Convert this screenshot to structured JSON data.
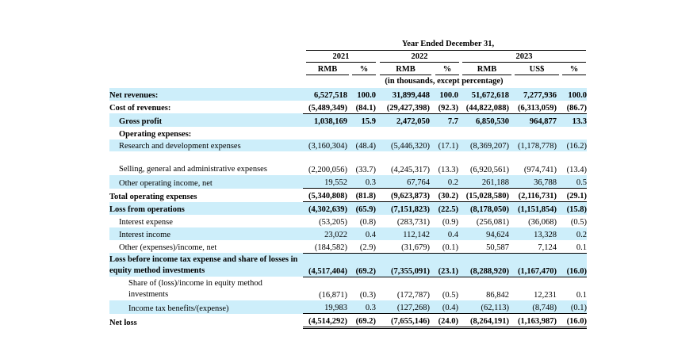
{
  "header": {
    "period_title": "Year Ended December 31,",
    "years": [
      "2021",
      "2022",
      "2023"
    ],
    "currencies": [
      "RMB",
      "%",
      "RMB",
      "%",
      "RMB",
      "US$",
      "%"
    ],
    "units_note": "(in thousands, except percentage)"
  },
  "rows": [
    {
      "label": "Net revenues:",
      "bold": true,
      "shaded": true,
      "indent": 0,
      "values": [
        "6,527,518",
        "100.0",
        "31,899,448",
        "100.0",
        "51,672,618",
        "7,277,936",
        "100.0"
      ]
    },
    {
      "label": "Cost of revenues:",
      "bold": true,
      "shaded": false,
      "indent": 0,
      "values": [
        "(5,489,349)",
        "(84.1)",
        "(29,427,398)",
        "(92.3)",
        "(44,822,088)",
        "(6,313,059)",
        "(86.7)"
      ]
    },
    {
      "label": "Gross profit",
      "bold": true,
      "shaded": true,
      "indent": 1,
      "values": [
        "1,038,169",
        "15.9",
        "2,472,050",
        "7.7",
        "6,850,530",
        "964,877",
        "13.3"
      ]
    },
    {
      "label": "Operating expenses:",
      "bold": true,
      "shaded": false,
      "indent": 1,
      "values": [
        "",
        "",
        "",
        "",
        "",
        "",
        ""
      ]
    },
    {
      "label": "Research and development expenses",
      "bold": false,
      "shaded": true,
      "indent": 1,
      "values": [
        "(3,160,304)",
        "(48.4)",
        "(5,446,320)",
        "(17.1)",
        "(8,369,207)",
        "(1,178,778)",
        "(16.2)"
      ]
    },
    {
      "label": "Selling, general and administrative expenses",
      "bold": false,
      "shaded": false,
      "indent": 1,
      "tall": true,
      "values": [
        "(2,200,056)",
        "(33.7)",
        "(4,245,317)",
        "(13.3)",
        "(6,920,561)",
        "(974,741)",
        "(13.4)"
      ]
    },
    {
      "label": "Other operating income, net",
      "bold": false,
      "shaded": true,
      "indent": 1,
      "values": [
        "19,552",
        "0.3",
        "67,764",
        "0.2",
        "261,188",
        "36,788",
        "0.5"
      ]
    },
    {
      "label": "Total operating expenses",
      "bold": true,
      "shaded": false,
      "indent": 0,
      "values": [
        "(5,340,808)",
        "(81.8)",
        "(9,623,873)",
        "(30.2)",
        "(15,028,580)",
        "(2,116,731)",
        "(29.1)"
      ]
    },
    {
      "label": "Loss from operations",
      "bold": true,
      "shaded": true,
      "indent": 0,
      "values": [
        "(4,302,639)",
        "(65.9)",
        "(7,151,823)",
        "(22.5)",
        "(8,178,050)",
        "(1,151,854)",
        "(15.8)"
      ]
    },
    {
      "label": "Interest expense",
      "bold": false,
      "shaded": false,
      "indent": 1,
      "values": [
        "(53,205)",
        "(0.8)",
        "(283,731)",
        "(0.9)",
        "(256,081)",
        "(36,068)",
        "(0.5)"
      ]
    },
    {
      "label": "Interest income",
      "bold": false,
      "shaded": true,
      "indent": 1,
      "values": [
        "23,022",
        "0.4",
        "112,142",
        "0.4",
        "94,624",
        "13,328",
        "0.2"
      ]
    },
    {
      "label": "Other (expenses)/income, net",
      "bold": false,
      "shaded": false,
      "indent": 1,
      "values": [
        "(184,582)",
        "(2.9)",
        "(31,679)",
        "(0.1)",
        "50,587",
        "7,124",
        "0.1"
      ]
    },
    {
      "label": "Loss before income tax expense and share of losses in equity method investments",
      "bold": true,
      "shaded": true,
      "indent": 0,
      "tall": true,
      "values": [
        "(4,517,404)",
        "(69.2)",
        "(7,355,091)",
        "(23.1)",
        "(8,288,920)",
        "(1,167,470)",
        "(16.0)"
      ]
    },
    {
      "label": "Share of (loss)/income in equity method investments",
      "bold": false,
      "shaded": false,
      "indent": 2,
      "tall": true,
      "values": [
        "(16,871)",
        "(0.3)",
        "(172,787)",
        "(0.5)",
        "86,842",
        "12,231",
        "0.1"
      ]
    },
    {
      "label": "Income tax benefits/(expense)",
      "bold": false,
      "shaded": true,
      "indent": 2,
      "values": [
        "19,983",
        "0.3",
        "(127,268)",
        "(0.4)",
        "(62,113)",
        "(8,748)",
        "(0.1)"
      ]
    },
    {
      "label": "Net loss",
      "bold": true,
      "shaded": false,
      "indent": 0,
      "values": [
        "(4,514,292)",
        "(69.2)",
        "(7,655,146)",
        "(24.0)",
        "(8,264,191)",
        "(1,163,987)",
        "(16.0)"
      ]
    }
  ]
}
